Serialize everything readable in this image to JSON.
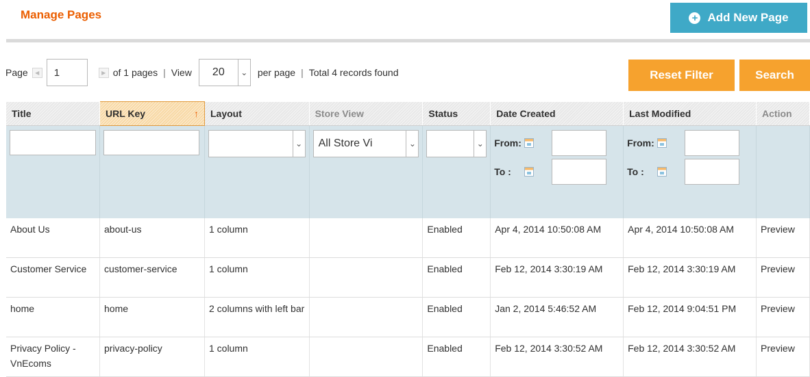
{
  "header": {
    "title": "Manage Pages",
    "add_button_label": "Add New Page",
    "add_button_icon": "plus-circle-icon"
  },
  "pager": {
    "page_label": "Page",
    "page_value": "1",
    "of_pages": "of 1 pages",
    "separator": "|",
    "view_label": "View",
    "view_value": "20",
    "per_page": "per page",
    "records": "Total 4 records found"
  },
  "actions": {
    "reset_filter": "Reset Filter",
    "search": "Search"
  },
  "columns": [
    "Title",
    "URL Key",
    "Layout",
    "Store View",
    "Status",
    "Date Created",
    "Last Modified",
    "Action"
  ],
  "filters": {
    "store_view_value": "All Store Vi",
    "from_label": "From:",
    "to_label": "To :"
  },
  "rows": [
    {
      "title": "About Us",
      "url_key": "about-us",
      "layout": "1 column",
      "store_view": "",
      "status": "Enabled",
      "date_created": "Apr 4, 2014 10:50:08 AM",
      "last_modified": "Apr 4, 2014 10:50:08 AM",
      "action": "Preview"
    },
    {
      "title": "Customer Service",
      "url_key": "customer-service",
      "layout": "1 column",
      "store_view": "",
      "status": "Enabled",
      "date_created": "Feb 12, 2014 3:30:19 AM",
      "last_modified": "Feb 12, 2014 3:30:19 AM",
      "action": "Preview"
    },
    {
      "title": "home",
      "url_key": "home",
      "layout": "2 columns with left bar",
      "store_view": "",
      "status": "Enabled",
      "date_created": "Jan 2, 2014 5:46:52 AM",
      "last_modified": "Feb 12, 2014 9:04:51 PM",
      "action": "Preview"
    },
    {
      "title": "Privacy Policy - VnEcoms",
      "url_key": "privacy-policy",
      "layout": "1 column",
      "store_view": "",
      "status": "Enabled",
      "date_created": "Feb 12, 2014 3:30:52 AM",
      "last_modified": "Feb 12, 2014 3:30:52 AM",
      "action": "Preview"
    }
  ],
  "colors": {
    "title_orange": "#eb5e00",
    "add_button_blue": "#3fa9c7",
    "action_orange": "#f6a22e",
    "filter_row_bg": "#d6e4ea"
  }
}
